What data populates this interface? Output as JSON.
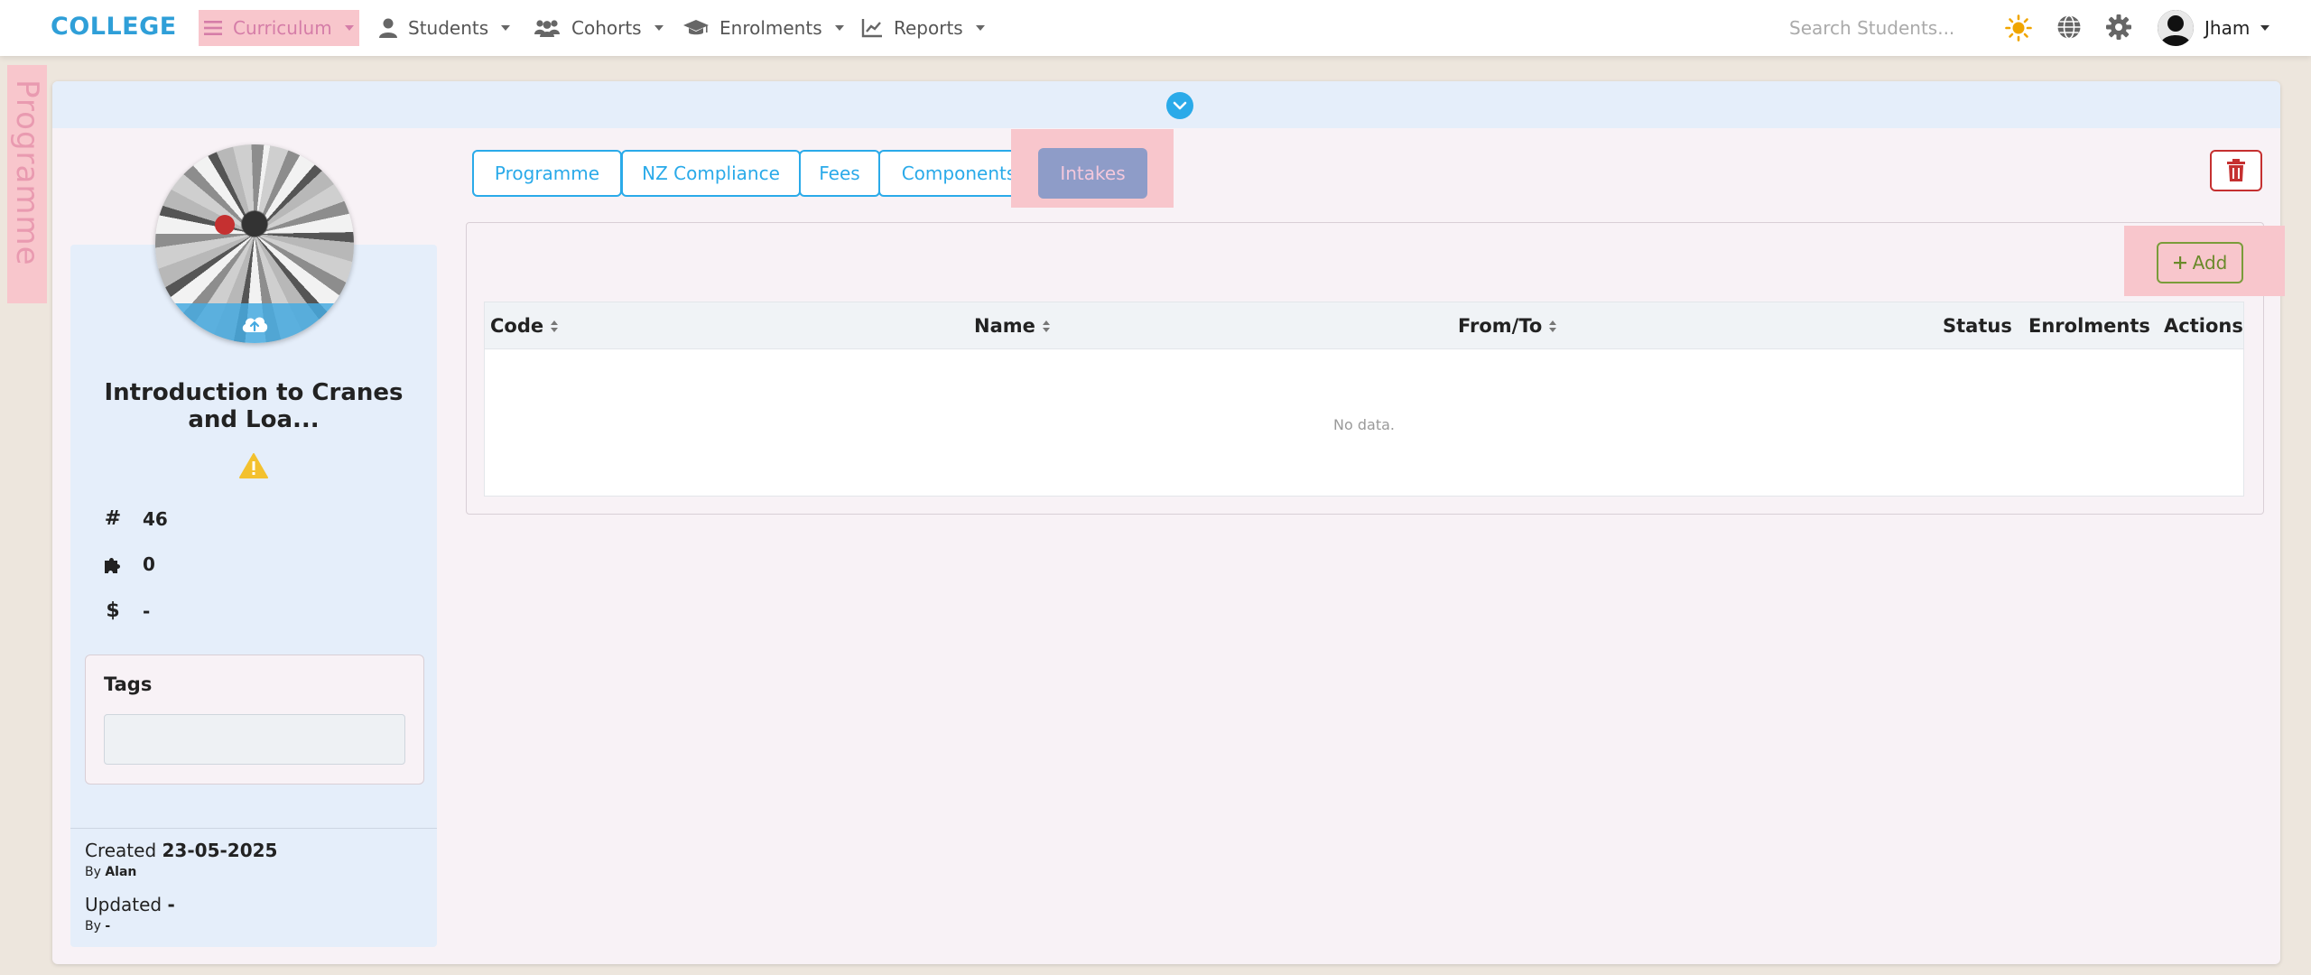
{
  "nav": {
    "brand": "COLLEGE",
    "items": [
      {
        "label": "Curriculum",
        "icon": "hamburger-icon"
      },
      {
        "label": "Students",
        "icon": "user-icon"
      },
      {
        "label": "Cohorts",
        "icon": "users-icon"
      },
      {
        "label": "Enrolments",
        "icon": "graduation-cap-icon"
      },
      {
        "label": "Reports",
        "icon": "line-chart-icon"
      }
    ],
    "search_placeholder": "Search Students...",
    "user_name": "Jham",
    "icons": [
      "sun-icon",
      "globe-icon",
      "gear-icon"
    ]
  },
  "side_tab": {
    "label": "Programme"
  },
  "programme": {
    "title": "Introduction to Cranes and Loa...",
    "stats": [
      {
        "icon": "hash-icon",
        "symbol": "#",
        "value": "46"
      },
      {
        "icon": "puzzle-icon",
        "symbol": "",
        "value": "0"
      },
      {
        "icon": "dollar-icon",
        "symbol": "$",
        "value": "-"
      }
    ],
    "tags_label": "Tags",
    "created_label": "Created",
    "created_date": "23-05-2025",
    "created_by_label": "By",
    "created_by": "Alan",
    "updated_label": "Updated",
    "updated_date": "-",
    "updated_by_label": "By",
    "updated_by": "-"
  },
  "tabs": [
    {
      "label": "Programme"
    },
    {
      "label": "NZ Compliance"
    },
    {
      "label": "Fees"
    },
    {
      "label": "Components"
    },
    {
      "label": "Intakes",
      "active": true
    }
  ],
  "intakes": {
    "add_label": "Add",
    "columns": [
      "Code",
      "Name",
      "From/To",
      "Status",
      "Enrolments",
      "Actions"
    ],
    "empty_text": "No data."
  },
  "colors": {
    "accent": "#2aaae9",
    "brand": "#2f9fd8",
    "danger": "#c53030",
    "add": "#7a9c3a",
    "highlight": "#f8c6cc"
  }
}
